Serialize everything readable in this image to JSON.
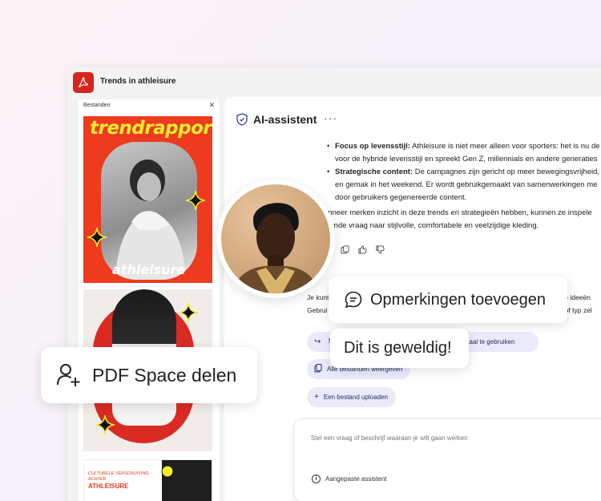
{
  "app": {
    "title": "Trends in athleisure",
    "brand_color": "#d7241c",
    "logo_icon": "acrobat-logo-icon"
  },
  "files_panel": {
    "header": "Bestanden",
    "close_icon": "close-icon",
    "thumbnails": [
      {
        "title": "trendrapport",
        "subtitle": "athleisure"
      },
      {
        "title": ""
      },
      {
        "kicker": "CULTURELE VERSCHUIVING ACHTER",
        "title": "ATHLEISURE"
      }
    ]
  },
  "ai_panel": {
    "title": "AI-assistent",
    "more_icon": "more-icon",
    "answer": {
      "bullet1_label": "Focus op levensstijl:",
      "bullet1_line1": " Athleisure is niet meer alleen voor sporters: het is nu de",
      "bullet1_line2": "voor de hybride levensstijl en spreekt Gen Z, millennials en andere generaties",
      "bullet2_label": "Strategische content:",
      "bullet2_line1": " De campagnes zijn gericht op meer bewegingsvrijheid,",
      "bullet2_line2": "en gemak in het weekend. Er wordt gebruikgemaakt van samenwerkingen me",
      "bullet2_line3": "door gebruikers gegenereerde content.",
      "para_line1": "anneer merken inzicht in deze trends en strategieën hebben, kunnen ze inspele",
      "para_line2": "eiende vraag naar stijlvolle, comfortabele en veelzijdige kleding."
    },
    "intro_line1_left": "Je kunt",
    "intro_line1_right": "ve ideeën",
    "intro_line2_left": "Gebrui",
    "intro_line2_right": ", of typ zel",
    "chips": [
      {
        "prefix": "M",
        "label": "ige taal te gebruiken"
      },
      {
        "label": "Alle bestanden weergeven"
      },
      {
        "label": "Een bestand uploaden"
      }
    ],
    "composer": {
      "placeholder": "Stel een vraag of beschrijf waaraan je wilt gaan werken",
      "assistant_label": "Aangepaste assistent"
    },
    "accent_color": "#ebeafb"
  },
  "overlays": {
    "comments_label": "Opmerkingen toevoegen",
    "great_label": "Dit is geweldig!",
    "share_label": "PDF Space delen"
  }
}
